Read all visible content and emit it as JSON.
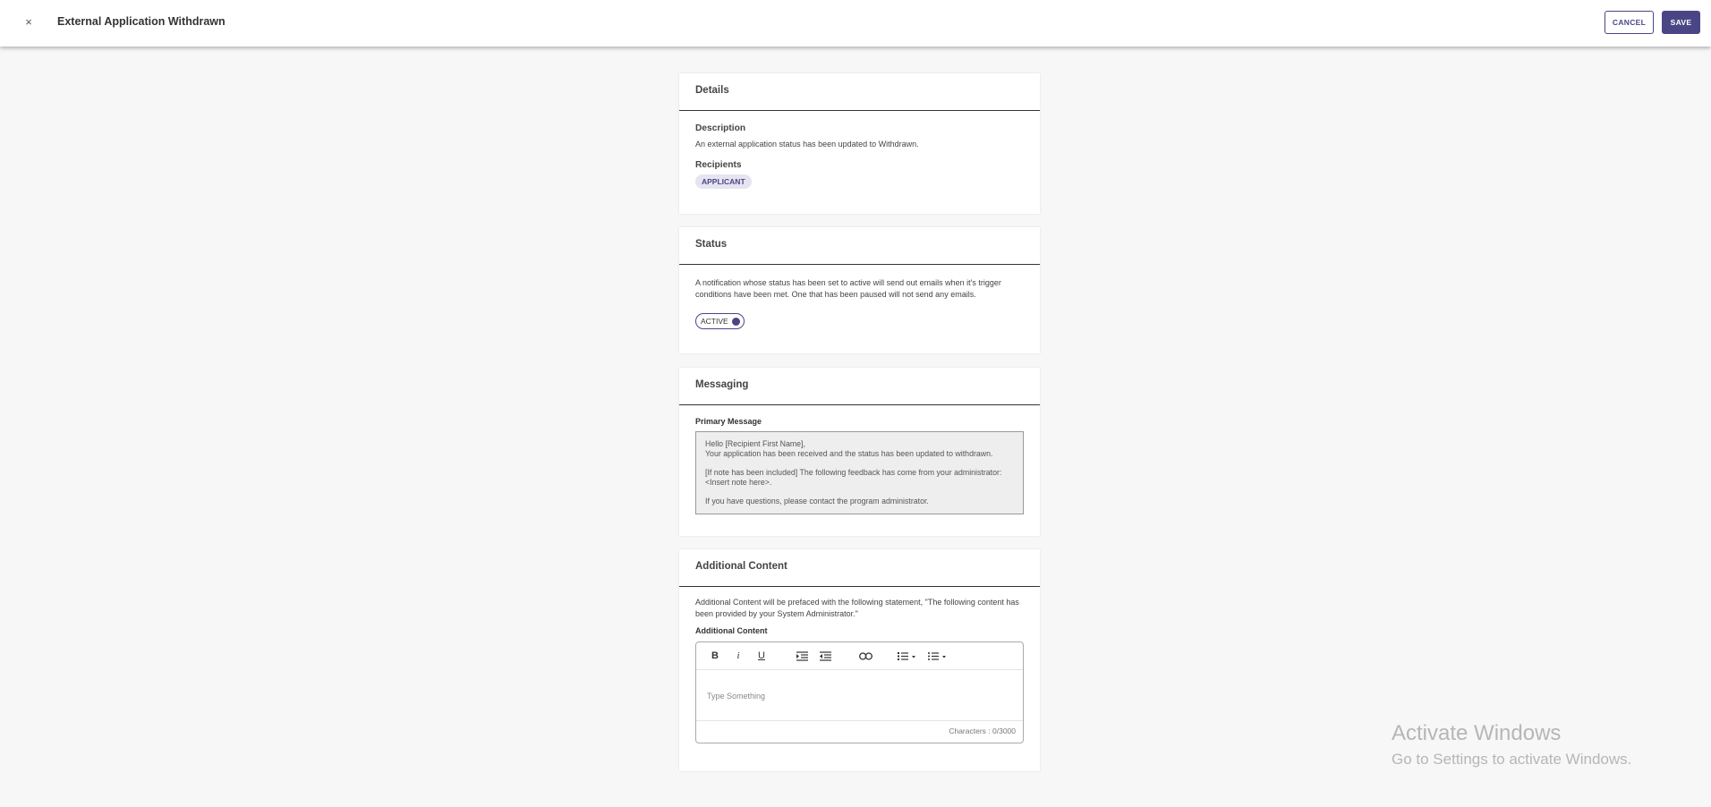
{
  "header": {
    "close_glyph": "×",
    "title": "External Application Withdrawn",
    "cancel_label": "CANCEL",
    "save_label": "SAVE"
  },
  "details": {
    "title": "Details",
    "description_label": "Description",
    "description_text": "An external application status has been updated to Withdrawn.",
    "recipients_label": "Recipients",
    "recipients": [
      "APPLICANT"
    ]
  },
  "status": {
    "title": "Status",
    "text": "A notification whose status has been set to active will send out emails when it's trigger conditions have been met. One that has been paused will not send any emails.",
    "toggle_label": "ACTIVE",
    "toggle_on": true
  },
  "messaging": {
    "title": "Messaging",
    "primary_label": "Primary Message",
    "lines": [
      "Hello [Recipient First Name],\nYour application has been received and the status has been updated to withdrawn.",
      "[If note has been included] The following feedback has come from your administrator: <Insert note here>.",
      "If you have questions, please contact the program administrator."
    ]
  },
  "additional": {
    "title": "Additional Content",
    "intro": "Additional Content will be prefaced with the following statement, \"The following content has been provided by your System Administrator.\"",
    "field_label": "Additional Content",
    "placeholder": "Type Something",
    "char_count": "Characters : 0/3000",
    "toolbar": [
      "bold-icon",
      "italic-icon",
      "underline-icon",
      "indent-icon",
      "outdent-icon",
      "link-icon",
      "ordered-list-icon",
      "bullet-list-icon"
    ]
  },
  "watermark": {
    "title": "Activate Windows",
    "subtitle": "Go to Settings to activate Windows."
  },
  "colors": {
    "accent": "#4a4686",
    "background": "#f7f7f7",
    "chip_bg": "#e6e4f1"
  }
}
